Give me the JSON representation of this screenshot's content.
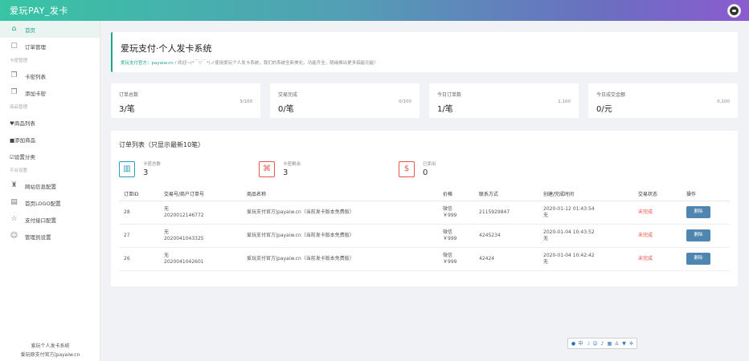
{
  "app": {
    "title": "爱玩PAY_发卡"
  },
  "sidebar": {
    "items": [
      {
        "label": "首页",
        "icon": "home-icon",
        "glyph": "⌂",
        "active": true
      },
      {
        "label": "订单管理",
        "icon": "calendar-icon",
        "glyph": "▢"
      },
      {
        "section": "卡密管理"
      },
      {
        "label": "卡密列表",
        "icon": "cards-icon",
        "glyph": "❐"
      },
      {
        "label": "添加卡密",
        "icon": "add-card-icon",
        "glyph": "❐"
      },
      {
        "section": "商品管理"
      },
      {
        "label": "♥商品列表",
        "icon": "",
        "glyph": ""
      },
      {
        "label": "■添加商品",
        "icon": "",
        "glyph": ""
      },
      {
        "label": "☑设置分类",
        "icon": "",
        "glyph": ""
      },
      {
        "section": "平台设置"
      },
      {
        "label": "网站信息配置",
        "icon": "tower-icon",
        "glyph": "♜"
      },
      {
        "label": "首页LOGO配置",
        "icon": "layout-icon",
        "glyph": "▤"
      },
      {
        "label": "支付接口配置",
        "icon": "star-icon",
        "glyph": "☆"
      },
      {
        "label": "管理员设置",
        "icon": "user-circle-icon",
        "glyph": "☺"
      }
    ],
    "footer": [
      "爱玩个人发卡系统",
      "爱玩原支付官方|payaiw.cn"
    ]
  },
  "header": {
    "page_title": "爱玩支付·个人发卡系统",
    "breadcrumb_link": "爱玩支付官方：payaiw.cn",
    "breadcrumb_sep": " / ",
    "breadcrumb_text": "欢迎~(*￣▽￣*)ノ使用爱玩个人发卡系统，我们的系统全新美化，功能齐全，随缘推出更多搞能功能！"
  },
  "stats": [
    {
      "label": "订单总数",
      "value": "3/笔",
      "cap": "3/100"
    },
    {
      "label": "交易完成",
      "value": "0/笔",
      "cap": "0/100"
    },
    {
      "label": "今日订单数",
      "value": "1/笔",
      "cap": "1,100"
    },
    {
      "label": "今日成交金额",
      "value": "0/元",
      "cap": "0,100"
    }
  ],
  "orders": {
    "title": "订单列表（只显示最新10笔）",
    "summary": [
      {
        "label": "卡密总数",
        "value": "3",
        "icon": "chart-icon",
        "glyph": "▥",
        "tone": "teal"
      },
      {
        "label": "卡密剩余",
        "value": "3",
        "icon": "tag-icon",
        "glyph": "⌘",
        "tone": "red"
      },
      {
        "label": "已卖出",
        "value": "0",
        "icon": "dollar-icon",
        "glyph": "$",
        "tone": "red"
      }
    ],
    "columns": [
      "订单ID",
      "交易号/商户订单号",
      "商品名称",
      "价格",
      "联系方式",
      "创建/完成时间",
      "交易状态",
      "操作"
    ],
    "rows": [
      {
        "id": "28",
        "trade_no": "无",
        "merchant_no": "2020012146772",
        "product": "爱玩支付官方|payaiw.cn（当前发卡版本免费版）",
        "pay_method": "微信",
        "price": "￥999",
        "contact": "2115929847",
        "created": "2020-01-12 01:43:54",
        "finished": "无",
        "status": "未完成",
        "action": "删除"
      },
      {
        "id": "27",
        "trade_no": "无",
        "merchant_no": "2020041043325",
        "product": "爱玩支付官方|payaiw.cn（当前发卡版本免费版）",
        "pay_method": "微信",
        "price": "￥999",
        "contact": "4245234",
        "created": "2020-01-04 10:43:52",
        "finished": "无",
        "status": "未完成",
        "action": "删除"
      },
      {
        "id": "26",
        "trade_no": "无",
        "merchant_no": "2020041042601",
        "product": "爱玩支付官方|payaiw.cn（当前发卡版本免费版）",
        "pay_method": "微信",
        "price": "￥999",
        "contact": "42424",
        "created": "2020-01-04 10:42:42",
        "finished": "无",
        "status": "未完成",
        "action": "删除"
      }
    ]
  },
  "floatbar": {
    "items": [
      {
        "icon": "s-logo-icon",
        "glyph": "●"
      },
      {
        "icon": "zh-icon",
        "glyph": "中"
      },
      {
        "icon": "moon-icon",
        "glyph": "☽"
      },
      {
        "icon": "emoji-icon",
        "glyph": "☺"
      },
      {
        "icon": "mic-icon",
        "glyph": "♪"
      },
      {
        "icon": "keyboard-icon",
        "glyph": "▦"
      },
      {
        "icon": "person-icon",
        "glyph": "♙"
      },
      {
        "icon": "shirt-icon",
        "glyph": "▼"
      },
      {
        "icon": "gear-icon",
        "glyph": "✲"
      }
    ]
  },
  "colors": {
    "accent": "#1aa88b",
    "danger": "#e84c3d",
    "button": "#4e86b0",
    "header_start": "#37c5a4",
    "header_end": "#8b5bd0"
  }
}
